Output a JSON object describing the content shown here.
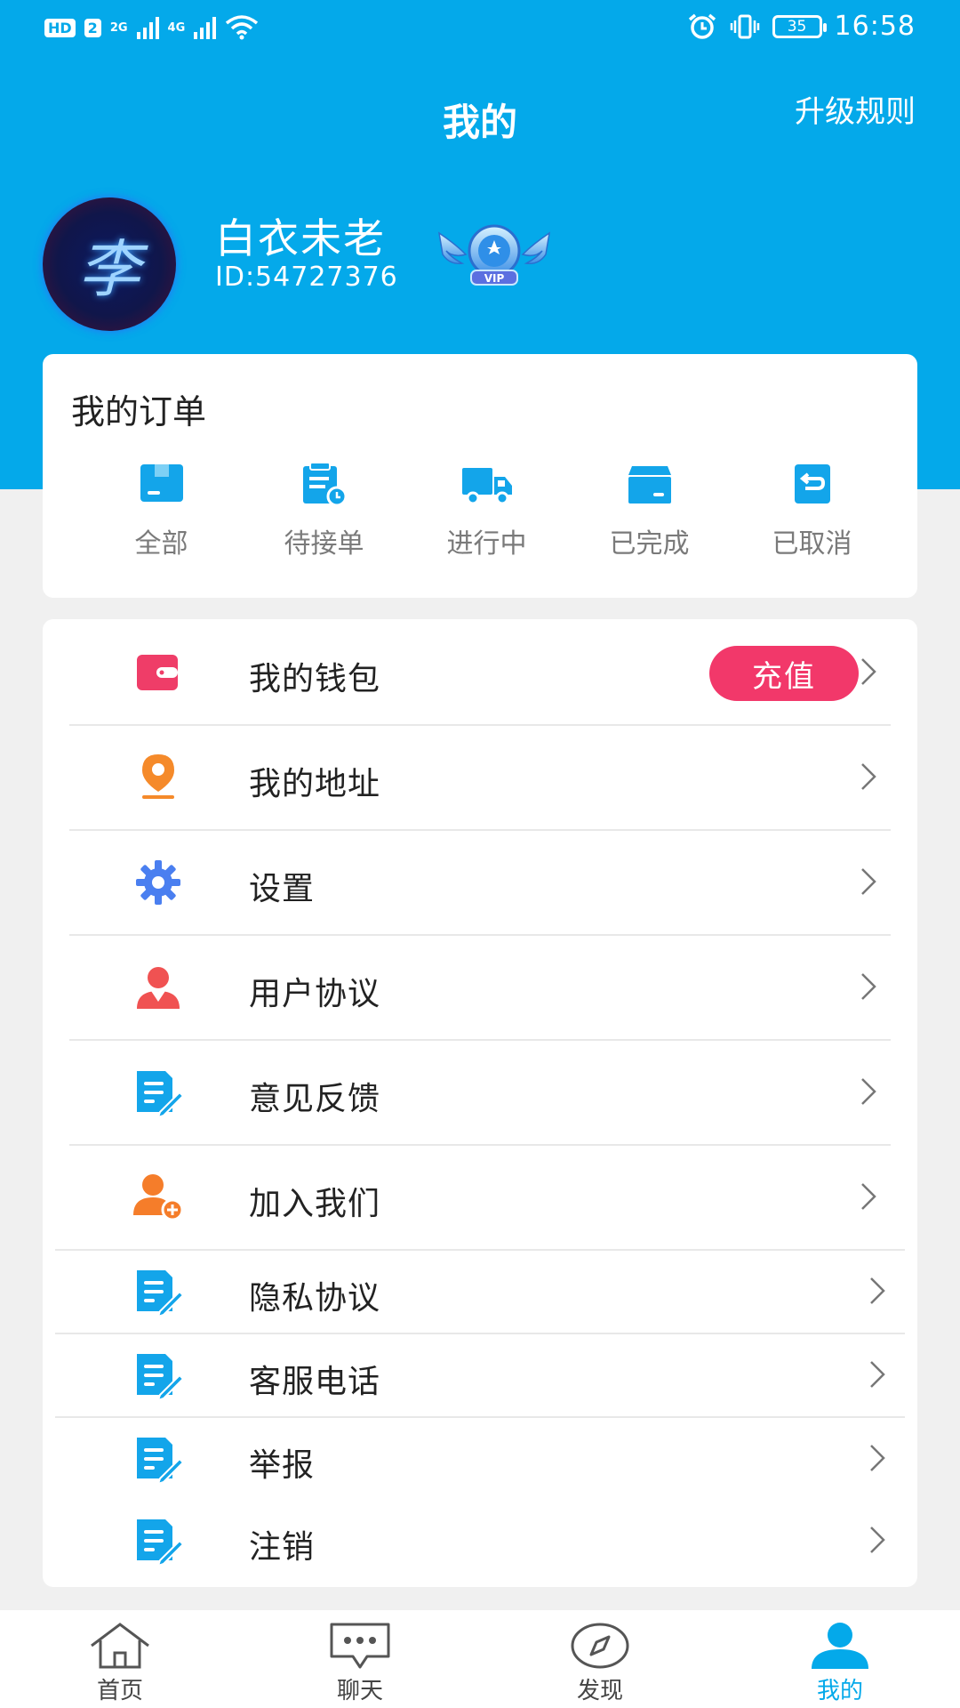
{
  "status_bar": {
    "hd": "HD",
    "sim": "2",
    "net1": "2G",
    "net2": "4G",
    "battery": "35",
    "time": "16:58"
  },
  "header": {
    "title": "我的",
    "upgrade_rules": "升级规则"
  },
  "profile": {
    "avatar_glyph": "李",
    "username": "白衣未老",
    "user_id": "ID:54727376",
    "vip_label": "VIP"
  },
  "orders": {
    "title": "我的订单",
    "tabs": [
      {
        "label": "全部",
        "icon": "all-orders-icon"
      },
      {
        "label": "待接单",
        "icon": "pending-orders-icon"
      },
      {
        "label": "进行中",
        "icon": "truck-icon"
      },
      {
        "label": "已完成",
        "icon": "box-done-icon"
      },
      {
        "label": "已取消",
        "icon": "cancel-order-icon"
      }
    ]
  },
  "menu": {
    "items": [
      {
        "label": "我的钱包",
        "icon": "wallet-icon",
        "action": "充值"
      },
      {
        "label": "我的地址",
        "icon": "location-pin-icon"
      },
      {
        "label": "设置",
        "icon": "gear-icon"
      },
      {
        "label": "用户协议",
        "icon": "user-icon"
      },
      {
        "label": "意见反馈",
        "icon": "feedback-doc-icon"
      },
      {
        "label": "加入我们",
        "icon": "add-user-icon"
      },
      {
        "label": "隐私协议",
        "icon": "privacy-doc-icon"
      },
      {
        "label": "客服电话",
        "icon": "service-doc-icon"
      },
      {
        "label": "举报",
        "icon": "report-doc-icon"
      },
      {
        "label": "注销",
        "icon": "logout-doc-icon"
      }
    ]
  },
  "tabbar": {
    "items": [
      {
        "label": "首页",
        "icon": "home-icon",
        "active": false
      },
      {
        "label": "聊天",
        "icon": "chat-icon",
        "active": false
      },
      {
        "label": "发现",
        "icon": "compass-icon",
        "active": false
      },
      {
        "label": "我的",
        "icon": "profile-icon",
        "active": true
      }
    ]
  },
  "colors": {
    "primary": "#04a9ea",
    "charge_button": "#f2386a",
    "wallet_icon": "#ef3d68",
    "location_icon": "#f58a2a",
    "gear_icon": "#4a7ff0",
    "user_icon": "#f05252",
    "doc_icon": "#13a5ea",
    "add_user_icon": "#f57d2a"
  }
}
